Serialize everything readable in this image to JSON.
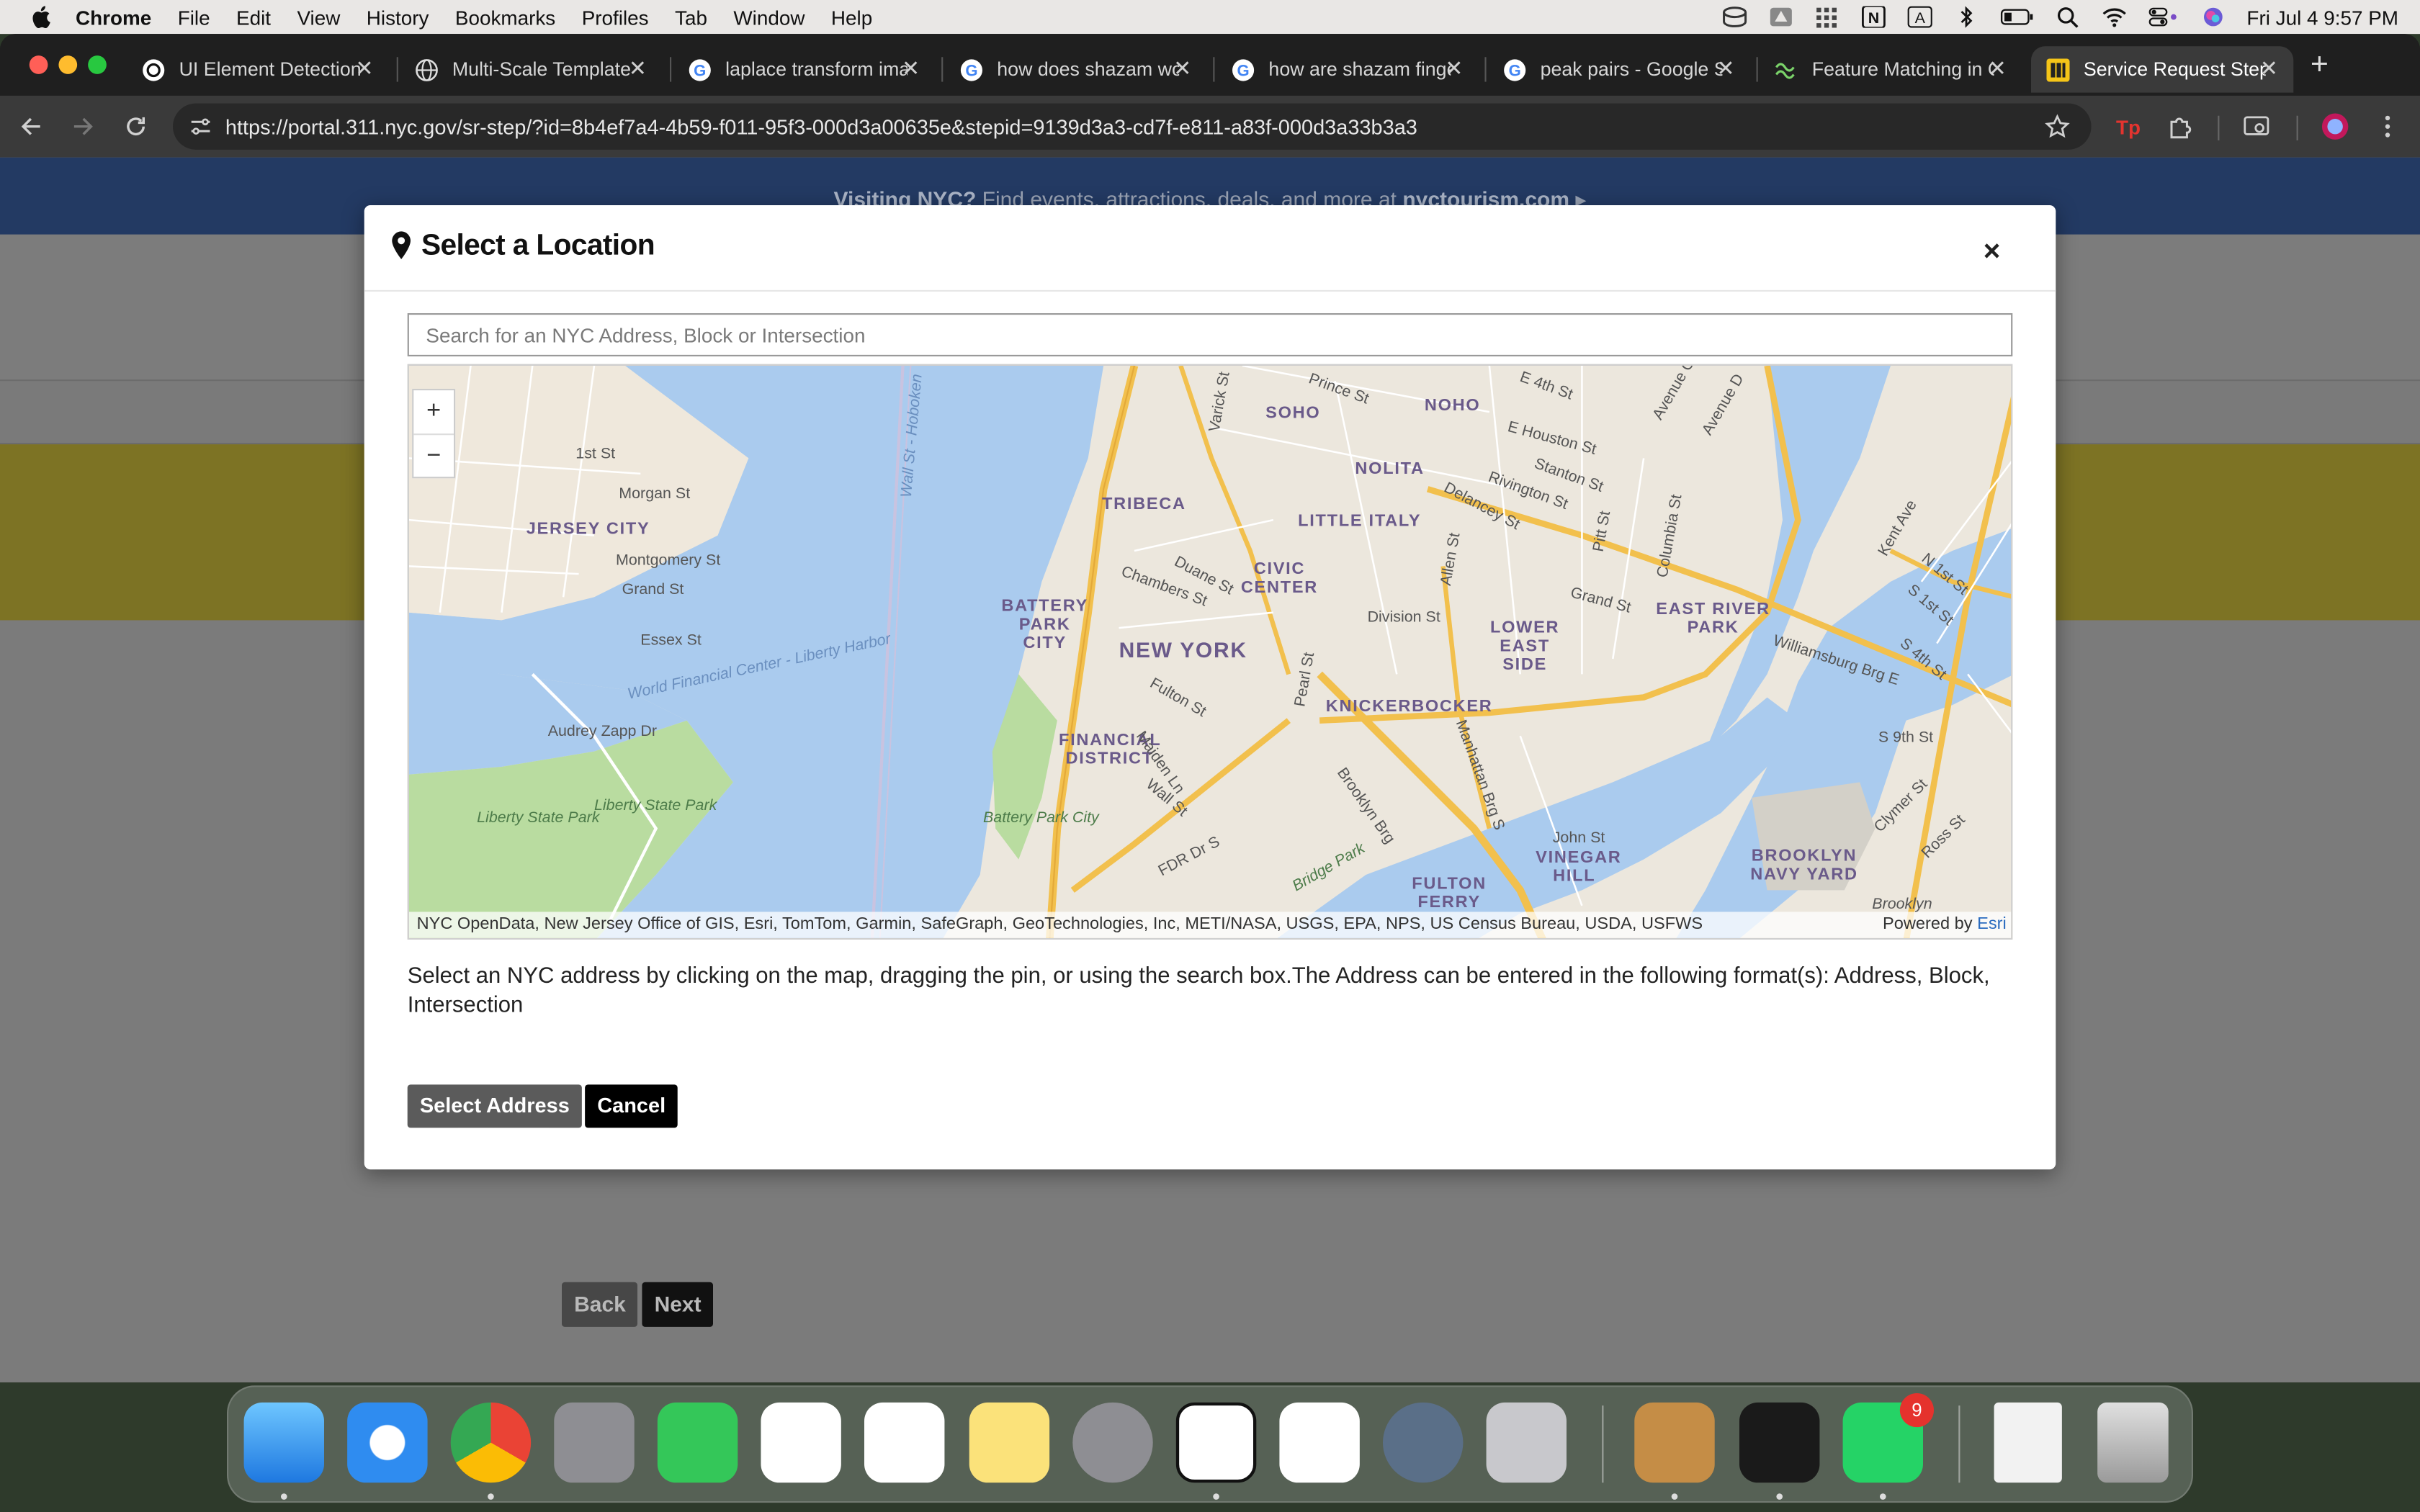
{
  "menubar": {
    "app": "Chrome",
    "items": [
      "File",
      "Edit",
      "View",
      "History",
      "Bookmarks",
      "Profiles",
      "Tab",
      "Window",
      "Help"
    ],
    "clock": "Fri Jul 4  9:57 PM"
  },
  "tabs": [
    {
      "title": "UI Element Detection",
      "icon": "openai-icon",
      "active": false
    },
    {
      "title": "Multi-Scale Template",
      "icon": "globe-icon",
      "active": false
    },
    {
      "title": "laplace transform image",
      "icon": "google-icon",
      "active": false
    },
    {
      "title": "how does shazam work",
      "icon": "google-icon",
      "active": false
    },
    {
      "title": "how are shazam fingerprints",
      "icon": "google-icon",
      "active": false
    },
    {
      "title": "peak pairs - Google Search",
      "icon": "google-icon",
      "active": false
    },
    {
      "title": "Feature Matching in OpenCV",
      "icon": "opencv-icon",
      "active": false
    },
    {
      "title": "Service Request Step",
      "icon": "nyc311-icon",
      "active": true
    }
  ],
  "address_bar": {
    "url": "https://portal.311.nyc.gov/sr-step/?id=8b4ef7a4-4b59-f011-95f3-000d3a00635e&stepid=9139d3a3-cd7f-e811-a83f-000d3a33b3a3"
  },
  "page": {
    "banner_prefix": "Visiting NYC?",
    "banner_text": " Find events, attractions, deals, and more at ",
    "banner_link": "nyctourism.com",
    "banner_arrow": " ▸",
    "back_label": "Back",
    "next_label": "Next"
  },
  "modal": {
    "title": "Select a Location",
    "close_label": "×",
    "search_placeholder": "Search for an NYC Address, Block or Intersection",
    "zoom_in": "+",
    "zoom_out": "−",
    "attribution": "NYC OpenData, New Jersey Office of GIS, Esri, TomTom, Garmin, SafeGraph, GeoTechnologies, Inc, METI/NASA, USGS, EPA, NPS, US Census Bureau, USDA, USFWS",
    "powered_by": "Powered by ",
    "powered_link": "Esri",
    "help_text": "Select an NYC address by clicking on the map, dragging the pin, or using the search box.The Address can be entered in the following format(s): Address, Block, Intersection",
    "select_button": "Select Address",
    "cancel_button": "Cancel"
  },
  "map_labels": {
    "districts": [
      "JERSEY CITY",
      "NEW YORK",
      "TRIBECA",
      "SOHO",
      "NOHO",
      "NOLITA",
      "LITTLE ITALY",
      "CIVIC CENTER",
      "BATTERY PARK CITY",
      "FINANCIAL DISTRICT",
      "KNICKERBOCKER",
      "LOWER EAST SIDE",
      "EAST RIVER PARK",
      "VINEGAR HILL",
      "BROOKLYN NAVY YARD",
      "FULTON FERRY"
    ],
    "streets": [
      "1st St",
      "Morgan St",
      "Montgomery St",
      "Grand St",
      "Essex St",
      "Audrey Zapp Dr",
      "Chambers St",
      "Duane St",
      "Fulton St",
      "Maiden Ln",
      "Wall St",
      "FDR Dr S",
      "Pearl St",
      "Division St",
      "Delancey St",
      "Grand St",
      "Allen St",
      "Pitt St",
      "Columbia St",
      "Rivington St",
      "Stanton St",
      "E Houston St",
      "E 4th St",
      "Prince St",
      "Varick St",
      "Williamsburg Brg E",
      "Brooklyn Brg",
      "Manhattan Brg S",
      "John St",
      "Kent Ave",
      "N 1st St",
      "S 1st St",
      "S 4th St",
      "S 9th St",
      "Ross St",
      "Clymer St",
      "Avenue D",
      "Avenue C",
      "Wall St - Hoboken",
      "World Financial Center - Liberty Harbor",
      "Bridge Park"
    ],
    "parks": [
      "Liberty State Park",
      "Battery Park City",
      "Brooklyn"
    ]
  },
  "dock": {
    "apps": [
      "finder-icon",
      "safari-icon",
      "chrome-icon",
      "launchpad-icon",
      "messages-icon",
      "jira-icon",
      "slack-icon",
      "notes-icon",
      "settings-icon",
      "notion-icon",
      "calendar-icon",
      "quicktime-icon",
      "iphone-mirroring-icon",
      "bear-icon",
      "cursor-icon",
      "whatsapp-icon",
      "document-icon",
      "trash-icon"
    ],
    "whatsapp_badge": "9"
  },
  "colors": {
    "chrome_dark": "#1f1f1f",
    "overlay_gray": "#7b7b7b",
    "banner_blue": "#233a63",
    "yellow_band": "#7d7324",
    "water": "#aacbee",
    "land": "#ece7dd",
    "highway": "#f2c04d",
    "park": "#b9dca0"
  }
}
